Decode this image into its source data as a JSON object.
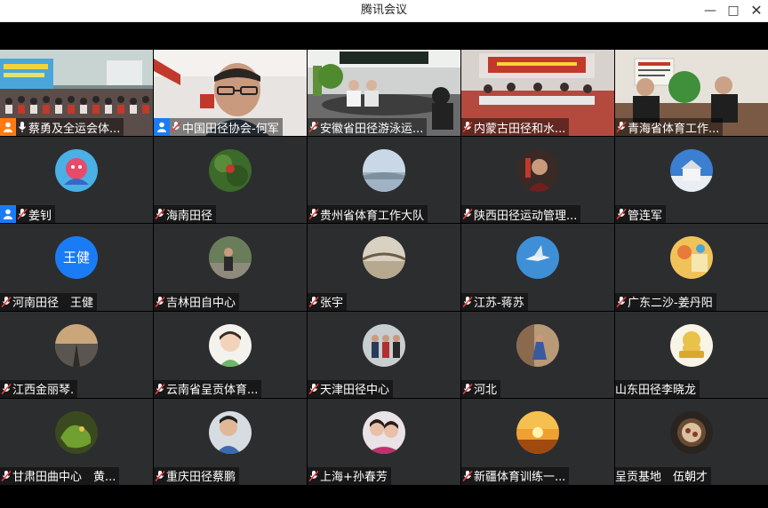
{
  "window": {
    "title": "腾讯会议"
  },
  "participants": [
    {
      "name": "蔡勇及全运会体...",
      "badge": "host-orange"
    },
    {
      "name": "中国田径协会-何军",
      "badge": "host"
    },
    {
      "name": "安徽省田径游泳运...",
      "badge": ""
    },
    {
      "name": "内蒙古田径和水...",
      "badge": ""
    },
    {
      "name": "青海省体育工作...",
      "badge": ""
    },
    {
      "name": "姜钊",
      "badge": "host"
    },
    {
      "name": "海南田径",
      "badge": ""
    },
    {
      "name": "贵州省体育工作大队",
      "badge": ""
    },
    {
      "name": "陕西田径运动管理...",
      "badge": ""
    },
    {
      "name": "管连军",
      "badge": ""
    },
    {
      "name": "河南田径　王健",
      "badge": "",
      "avatar_text": "王健"
    },
    {
      "name": "吉林田自中心",
      "badge": ""
    },
    {
      "name": "张宇",
      "badge": ""
    },
    {
      "name": "江苏-蒋苏",
      "badge": ""
    },
    {
      "name": "广东二沙-姜丹阳",
      "badge": ""
    },
    {
      "name": "江西金丽琴.",
      "badge": ""
    },
    {
      "name": "云南省呈贡体育...",
      "badge": ""
    },
    {
      "name": "天津田径中心",
      "badge": ""
    },
    {
      "name": "河北",
      "badge": ""
    },
    {
      "name": "山东田径李晓龙",
      "badge": ""
    },
    {
      "name": "甘肃田曲中心　黄...",
      "badge": ""
    },
    {
      "name": "重庆田径蔡鹏",
      "badge": ""
    },
    {
      "name": "上海+孙春芳",
      "badge": ""
    },
    {
      "name": "新疆体育训练一...",
      "badge": ""
    },
    {
      "name": "呈贡基地　伍朝才",
      "badge": ""
    }
  ]
}
